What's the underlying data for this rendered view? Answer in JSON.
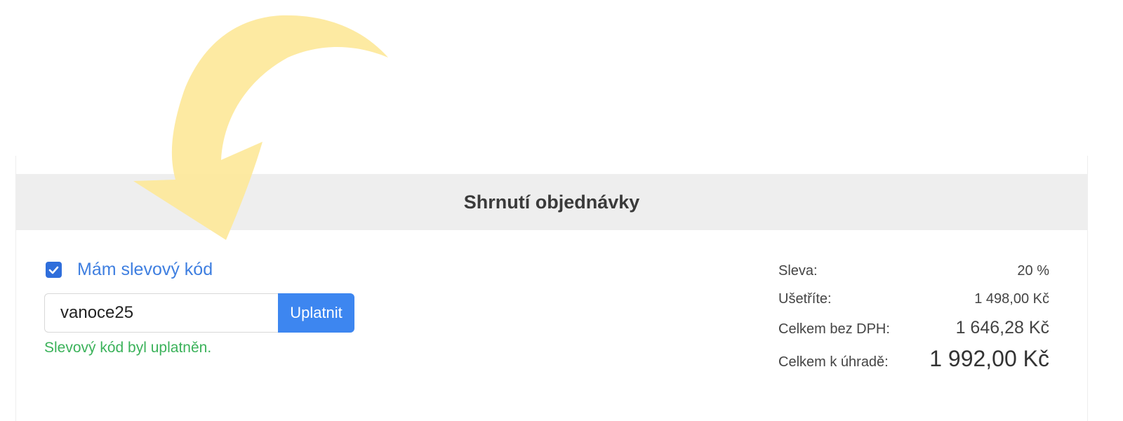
{
  "summary_panel": {
    "title": "Shrnutí objednávky"
  },
  "discount": {
    "has_code_checked": true,
    "has_code_label": "Mám slevový kód",
    "code_value": "vanoce25",
    "apply_label": "Uplatnit",
    "success_message": "Slevový kód byl uplatněn."
  },
  "totals": {
    "discount_label": "Sleva:",
    "discount_value": "20 %",
    "saving_label": "Ušetříte:",
    "saving_value": "1 498,00 Kč",
    "net_label": "Celkem bez DPH:",
    "net_value": "1 646,28 Kč",
    "total_label": "Celkem k úhradě:",
    "total_value": "1 992,00 Kč"
  },
  "colors": {
    "accent": "#3d86f0",
    "checkbox": "#2f6edb",
    "link": "#3f7fe0",
    "success": "#3bb25a",
    "header_bg": "#eeeeee",
    "annotation_arrow": "#fde89a"
  },
  "icons": {
    "checkbox_mark": "check-icon",
    "annotation": "curved-arrow-icon"
  }
}
